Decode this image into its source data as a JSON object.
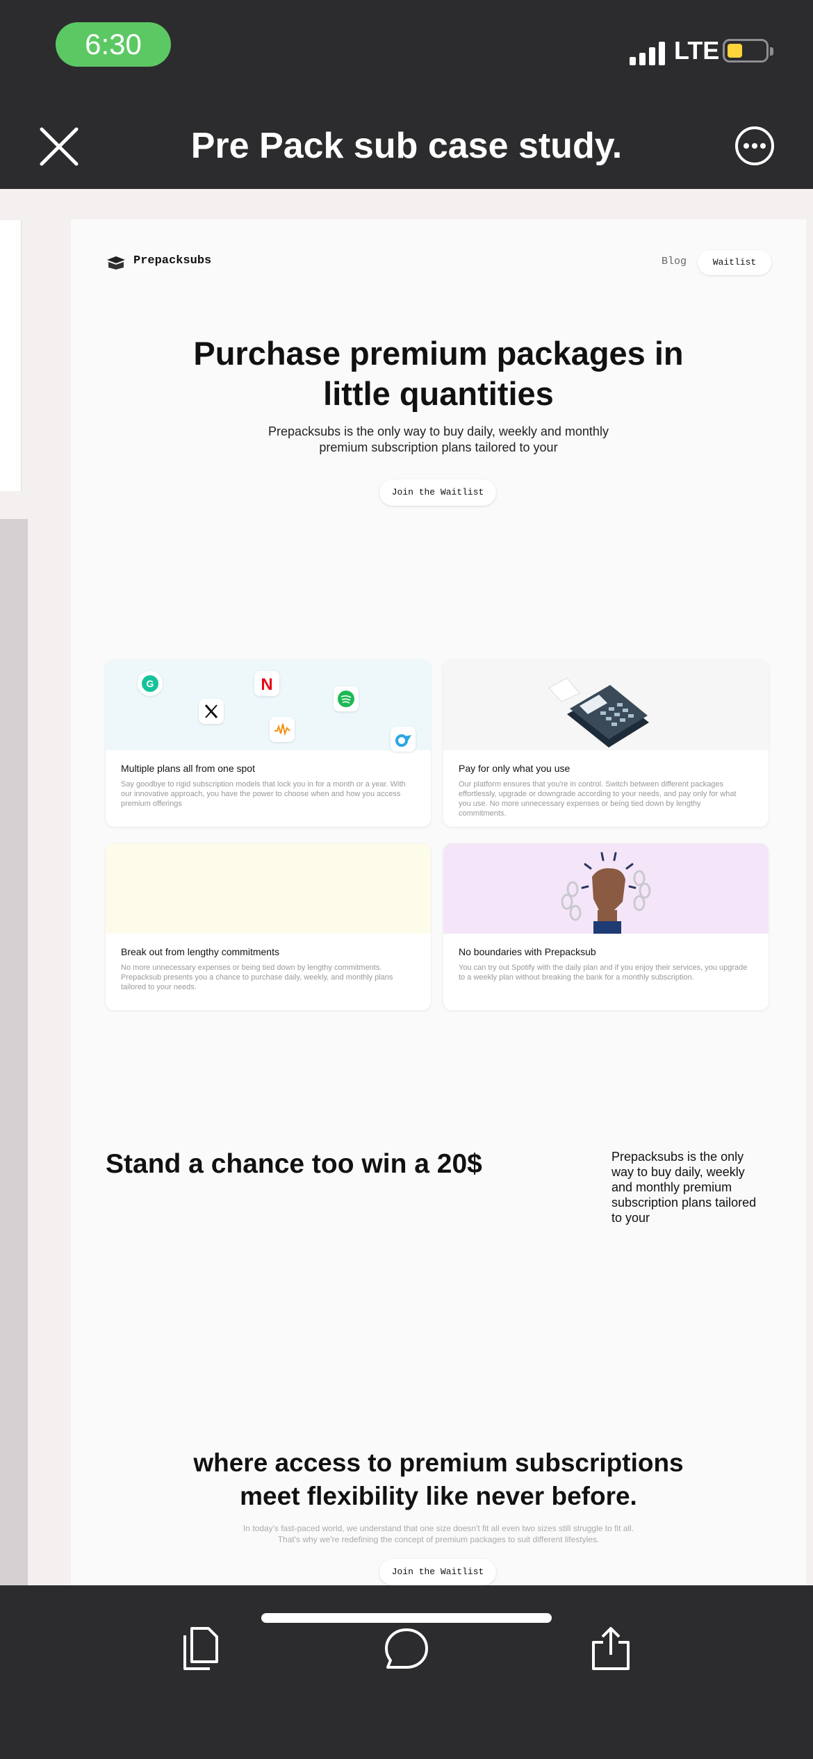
{
  "status_bar": {
    "time": "6:30",
    "network": "LTE",
    "battery_level": 0.4,
    "battery_color": "#ffd43b",
    "pill_color": "#5cc863"
  },
  "nav": {
    "title": "Pre Pack sub case study.",
    "close_icon": "close-icon",
    "more_icon": "more-icon"
  },
  "site": {
    "brand": "Prepacksubs",
    "nav": {
      "blog": "Blog",
      "waitlist": "Waitlist"
    },
    "hero": {
      "title_line1": "Purchase premium packages in",
      "title_line2": "little quantities",
      "subtitle_line1": "Prepacksubs is the only way to buy daily, weekly and monthly",
      "subtitle_line2": "premium subscription plans tailored to your",
      "cta": "Join the Waitlist"
    },
    "features": [
      {
        "title": "Multiple plans all from one spot",
        "text": "Say goodbye to rigid subscription models that lock you in for a month or a year. With our innovative approach, you have the power to choose when and how you access premium offerings",
        "bg": "#eef8fb"
      },
      {
        "title": "Pay for only what you use",
        "text": "Our platform ensures that you're in control. Switch between different packages effortlessly, upgrade or downgrade according to your needs, and pay only for what you use. No more unnecessary expenses or being tied down by lengthy commitments.",
        "bg": "#f6f6f6"
      },
      {
        "title": "Break out from lengthy commitments",
        "text": "No more unnecessary expenses or being tied down by lengthy commitments. Prepacksub presents you a chance to purchase daily, weekly, and monthly plans tailored to your needs.",
        "bg": "#fdfbea"
      },
      {
        "title": "No boundaries with Prepacksub",
        "text": "You can try out Spotify with the daily plan and if you enjoy their services, you upgrade to a weekly plan without breaking the bank for a monthly subscription.",
        "bg": "#f4e6f8"
      }
    ],
    "prize": {
      "title": "Stand a chance too win a 20$",
      "text": "Prepacksubs is the only way to buy daily, weekly and monthly premium subscription plans tailored to your"
    },
    "flex": {
      "title_line1": "where access to premium subscriptions",
      "title_line2": "meet flexibility like never before.",
      "sub_line1": "In today's fast-paced world, we understand that one size doesn't fit all even two sizes still struggle to fit all.",
      "sub_line2": "That's why we're redefining the concept of premium packages to suit different lifestyles.",
      "cta": "Join the Waitlist"
    }
  },
  "toolbar": {
    "copy_icon": "copy-icon",
    "comment_icon": "comment-icon",
    "share_icon": "share-icon"
  }
}
